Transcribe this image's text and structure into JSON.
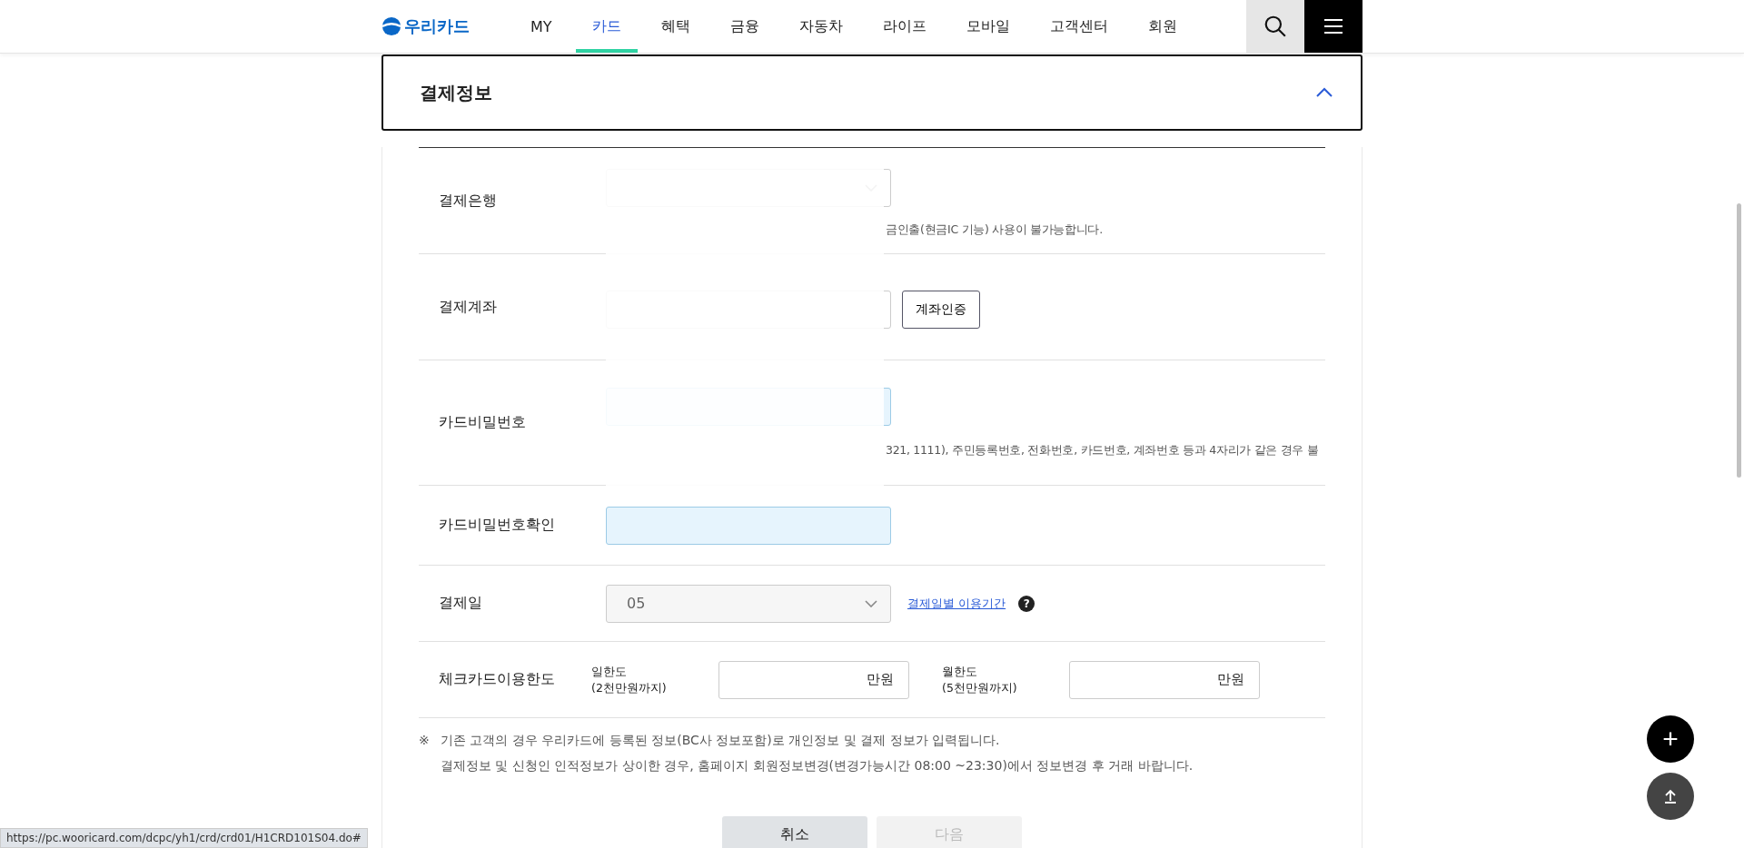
{
  "header": {
    "logo": "우리카드",
    "nav": [
      {
        "label": "MY",
        "selected": false
      },
      {
        "label": "카드",
        "selected": true
      },
      {
        "label": "혜택",
        "selected": false
      },
      {
        "label": "금융",
        "selected": false
      },
      {
        "label": "자동차",
        "selected": false
      },
      {
        "label": "라이프",
        "selected": false
      },
      {
        "label": "모바일",
        "selected": false
      },
      {
        "label": "고객센터",
        "selected": false
      },
      {
        "label": "회원",
        "selected": false
      }
    ]
  },
  "section": {
    "title": "결제정보",
    "expanded": true
  },
  "rows": [
    {
      "kind": "bank",
      "label": "결제은행",
      "note": "금인출(현금IC 기능) 사용이 불가능합니다."
    },
    {
      "kind": "account",
      "label": "결제계좌",
      "button": "계좌인증"
    },
    {
      "kind": "password",
      "label": "카드비밀번호",
      "note": "321, 1111), 주민등록번호, 전화번호, 카드번호, 계좌번호 등과 4자리가 같은 경우 불"
    },
    {
      "kind": "password",
      "label": "카드비밀번호확인"
    },
    {
      "kind": "date",
      "label": "결제일",
      "value": "05",
      "disabled": true,
      "link": "결제일별 이용기간",
      "help": "?"
    },
    {
      "kind": "limits",
      "label": "체크카드이용한도",
      "limits": [
        {
          "label": "일한도",
          "sub": "(2천만원까지)",
          "unit": "만원"
        },
        {
          "label": "월한도",
          "sub": "(5천만원까지)",
          "unit": "만원"
        }
      ]
    }
  ],
  "notice": {
    "mark": "※",
    "lines": [
      "기존 고객의 경우 우리카드에 등록된 정보(BC사 정보포함)로 개인정보 및 결제 정보가 입력됩니다.",
      "결제정보 및 신청인 인적정보가 상이한 경우, 홈페이지 회원정보변경(변경가능시간 08:00 ~23:30)에서 정보변경 후 거래 바랍니다."
    ]
  },
  "buttons": [
    {
      "label": "취소",
      "disabled": false
    },
    {
      "label": "다음",
      "disabled": true
    }
  ],
  "fabs": [
    "+"
  ],
  "status_url": "https://pc.wooricard.com/dcpc/yh1/crd/crd01/H1CRD101S04.do#"
}
